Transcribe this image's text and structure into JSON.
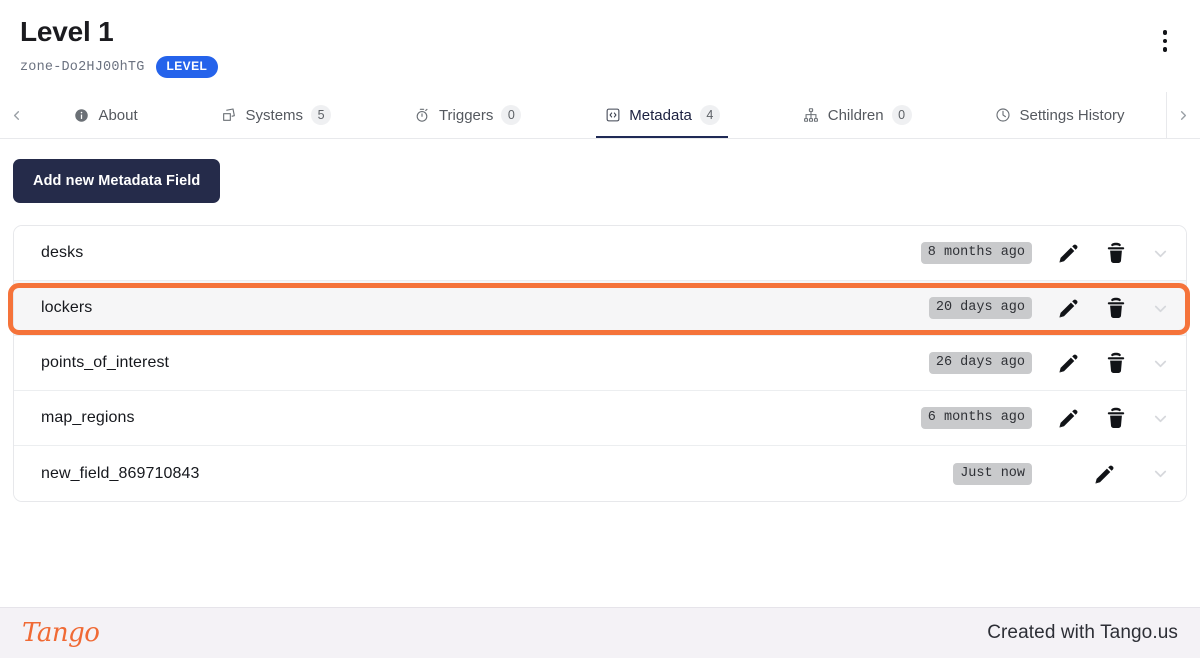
{
  "header": {
    "title": "Level 1",
    "zone_id": "zone-Do2HJ00hTG",
    "badge": "LEVEL",
    "menu_icon": "kebab-menu-icon"
  },
  "tabbar": {
    "prev_icon": "chevron-left-icon",
    "next_icon": "chevron-right-icon",
    "tabs": [
      {
        "label": "About",
        "icon": "info-icon",
        "count": ""
      },
      {
        "label": "Systems",
        "icon": "layers-icon",
        "count": "5"
      },
      {
        "label": "Triggers",
        "icon": "stopwatch-icon",
        "count": "0"
      },
      {
        "label": "Metadata",
        "icon": "code-box-icon",
        "count": "4",
        "active": true
      },
      {
        "label": "Children",
        "icon": "sitemap-icon",
        "count": "0"
      },
      {
        "label": "Settings History",
        "icon": "clock-icon",
        "count": ""
      }
    ]
  },
  "toolbar": {
    "add_label": "Add new Metadata Field"
  },
  "list": {
    "edit_icon": "pencil-icon",
    "delete_icon": "trash-icon",
    "expand_icon": "chevron-down-icon",
    "rows": [
      {
        "name": "desks",
        "time": "8 months ago",
        "can_delete": true
      },
      {
        "name": "lockers",
        "time": "20 days ago",
        "can_delete": true,
        "highlighted": true
      },
      {
        "name": "points_of_interest",
        "time": "26 days ago",
        "can_delete": true
      },
      {
        "name": "map_regions",
        "time": "6 months ago",
        "can_delete": true
      },
      {
        "name": "new_field_869710843",
        "time": "Just now",
        "can_delete": false
      }
    ]
  },
  "footer": {
    "logo": "Tango",
    "text": "Created with Tango.us"
  },
  "colors": {
    "accent_highlight": "#f5733a",
    "brand_dark": "#252b4a",
    "badge_blue": "#2563eb",
    "tango_orange": "#f06a35"
  }
}
